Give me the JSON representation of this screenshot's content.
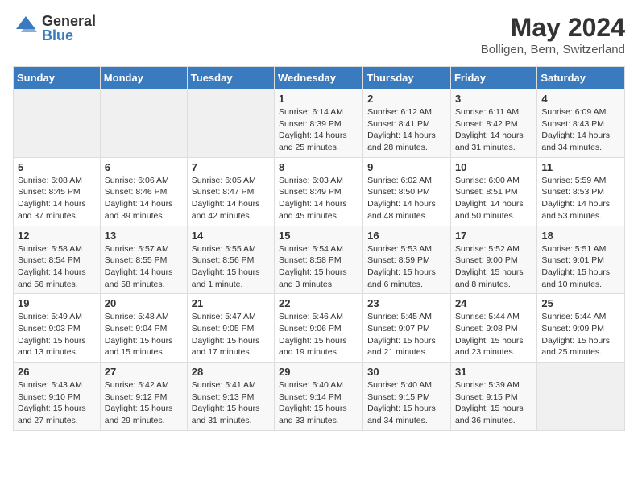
{
  "header": {
    "logo_general": "General",
    "logo_blue": "Blue",
    "month_year": "May 2024",
    "location": "Bolligen, Bern, Switzerland"
  },
  "weekdays": [
    "Sunday",
    "Monday",
    "Tuesday",
    "Wednesday",
    "Thursday",
    "Friday",
    "Saturday"
  ],
  "weeks": [
    [
      {
        "day": "",
        "info": ""
      },
      {
        "day": "",
        "info": ""
      },
      {
        "day": "",
        "info": ""
      },
      {
        "day": "1",
        "info": "Sunrise: 6:14 AM\nSunset: 8:39 PM\nDaylight: 14 hours\nand 25 minutes."
      },
      {
        "day": "2",
        "info": "Sunrise: 6:12 AM\nSunset: 8:41 PM\nDaylight: 14 hours\nand 28 minutes."
      },
      {
        "day": "3",
        "info": "Sunrise: 6:11 AM\nSunset: 8:42 PM\nDaylight: 14 hours\nand 31 minutes."
      },
      {
        "day": "4",
        "info": "Sunrise: 6:09 AM\nSunset: 8:43 PM\nDaylight: 14 hours\nand 34 minutes."
      }
    ],
    [
      {
        "day": "5",
        "info": "Sunrise: 6:08 AM\nSunset: 8:45 PM\nDaylight: 14 hours\nand 37 minutes."
      },
      {
        "day": "6",
        "info": "Sunrise: 6:06 AM\nSunset: 8:46 PM\nDaylight: 14 hours\nand 39 minutes."
      },
      {
        "day": "7",
        "info": "Sunrise: 6:05 AM\nSunset: 8:47 PM\nDaylight: 14 hours\nand 42 minutes."
      },
      {
        "day": "8",
        "info": "Sunrise: 6:03 AM\nSunset: 8:49 PM\nDaylight: 14 hours\nand 45 minutes."
      },
      {
        "day": "9",
        "info": "Sunrise: 6:02 AM\nSunset: 8:50 PM\nDaylight: 14 hours\nand 48 minutes."
      },
      {
        "day": "10",
        "info": "Sunrise: 6:00 AM\nSunset: 8:51 PM\nDaylight: 14 hours\nand 50 minutes."
      },
      {
        "day": "11",
        "info": "Sunrise: 5:59 AM\nSunset: 8:53 PM\nDaylight: 14 hours\nand 53 minutes."
      }
    ],
    [
      {
        "day": "12",
        "info": "Sunrise: 5:58 AM\nSunset: 8:54 PM\nDaylight: 14 hours\nand 56 minutes."
      },
      {
        "day": "13",
        "info": "Sunrise: 5:57 AM\nSunset: 8:55 PM\nDaylight: 14 hours\nand 58 minutes."
      },
      {
        "day": "14",
        "info": "Sunrise: 5:55 AM\nSunset: 8:56 PM\nDaylight: 15 hours\nand 1 minute."
      },
      {
        "day": "15",
        "info": "Sunrise: 5:54 AM\nSunset: 8:58 PM\nDaylight: 15 hours\nand 3 minutes."
      },
      {
        "day": "16",
        "info": "Sunrise: 5:53 AM\nSunset: 8:59 PM\nDaylight: 15 hours\nand 6 minutes."
      },
      {
        "day": "17",
        "info": "Sunrise: 5:52 AM\nSunset: 9:00 PM\nDaylight: 15 hours\nand 8 minutes."
      },
      {
        "day": "18",
        "info": "Sunrise: 5:51 AM\nSunset: 9:01 PM\nDaylight: 15 hours\nand 10 minutes."
      }
    ],
    [
      {
        "day": "19",
        "info": "Sunrise: 5:49 AM\nSunset: 9:03 PM\nDaylight: 15 hours\nand 13 minutes."
      },
      {
        "day": "20",
        "info": "Sunrise: 5:48 AM\nSunset: 9:04 PM\nDaylight: 15 hours\nand 15 minutes."
      },
      {
        "day": "21",
        "info": "Sunrise: 5:47 AM\nSunset: 9:05 PM\nDaylight: 15 hours\nand 17 minutes."
      },
      {
        "day": "22",
        "info": "Sunrise: 5:46 AM\nSunset: 9:06 PM\nDaylight: 15 hours\nand 19 minutes."
      },
      {
        "day": "23",
        "info": "Sunrise: 5:45 AM\nSunset: 9:07 PM\nDaylight: 15 hours\nand 21 minutes."
      },
      {
        "day": "24",
        "info": "Sunrise: 5:44 AM\nSunset: 9:08 PM\nDaylight: 15 hours\nand 23 minutes."
      },
      {
        "day": "25",
        "info": "Sunrise: 5:44 AM\nSunset: 9:09 PM\nDaylight: 15 hours\nand 25 minutes."
      }
    ],
    [
      {
        "day": "26",
        "info": "Sunrise: 5:43 AM\nSunset: 9:10 PM\nDaylight: 15 hours\nand 27 minutes."
      },
      {
        "day": "27",
        "info": "Sunrise: 5:42 AM\nSunset: 9:12 PM\nDaylight: 15 hours\nand 29 minutes."
      },
      {
        "day": "28",
        "info": "Sunrise: 5:41 AM\nSunset: 9:13 PM\nDaylight: 15 hours\nand 31 minutes."
      },
      {
        "day": "29",
        "info": "Sunrise: 5:40 AM\nSunset: 9:14 PM\nDaylight: 15 hours\nand 33 minutes."
      },
      {
        "day": "30",
        "info": "Sunrise: 5:40 AM\nSunset: 9:15 PM\nDaylight: 15 hours\nand 34 minutes."
      },
      {
        "day": "31",
        "info": "Sunrise: 5:39 AM\nSunset: 9:15 PM\nDaylight: 15 hours\nand 36 minutes."
      },
      {
        "day": "",
        "info": ""
      }
    ]
  ]
}
